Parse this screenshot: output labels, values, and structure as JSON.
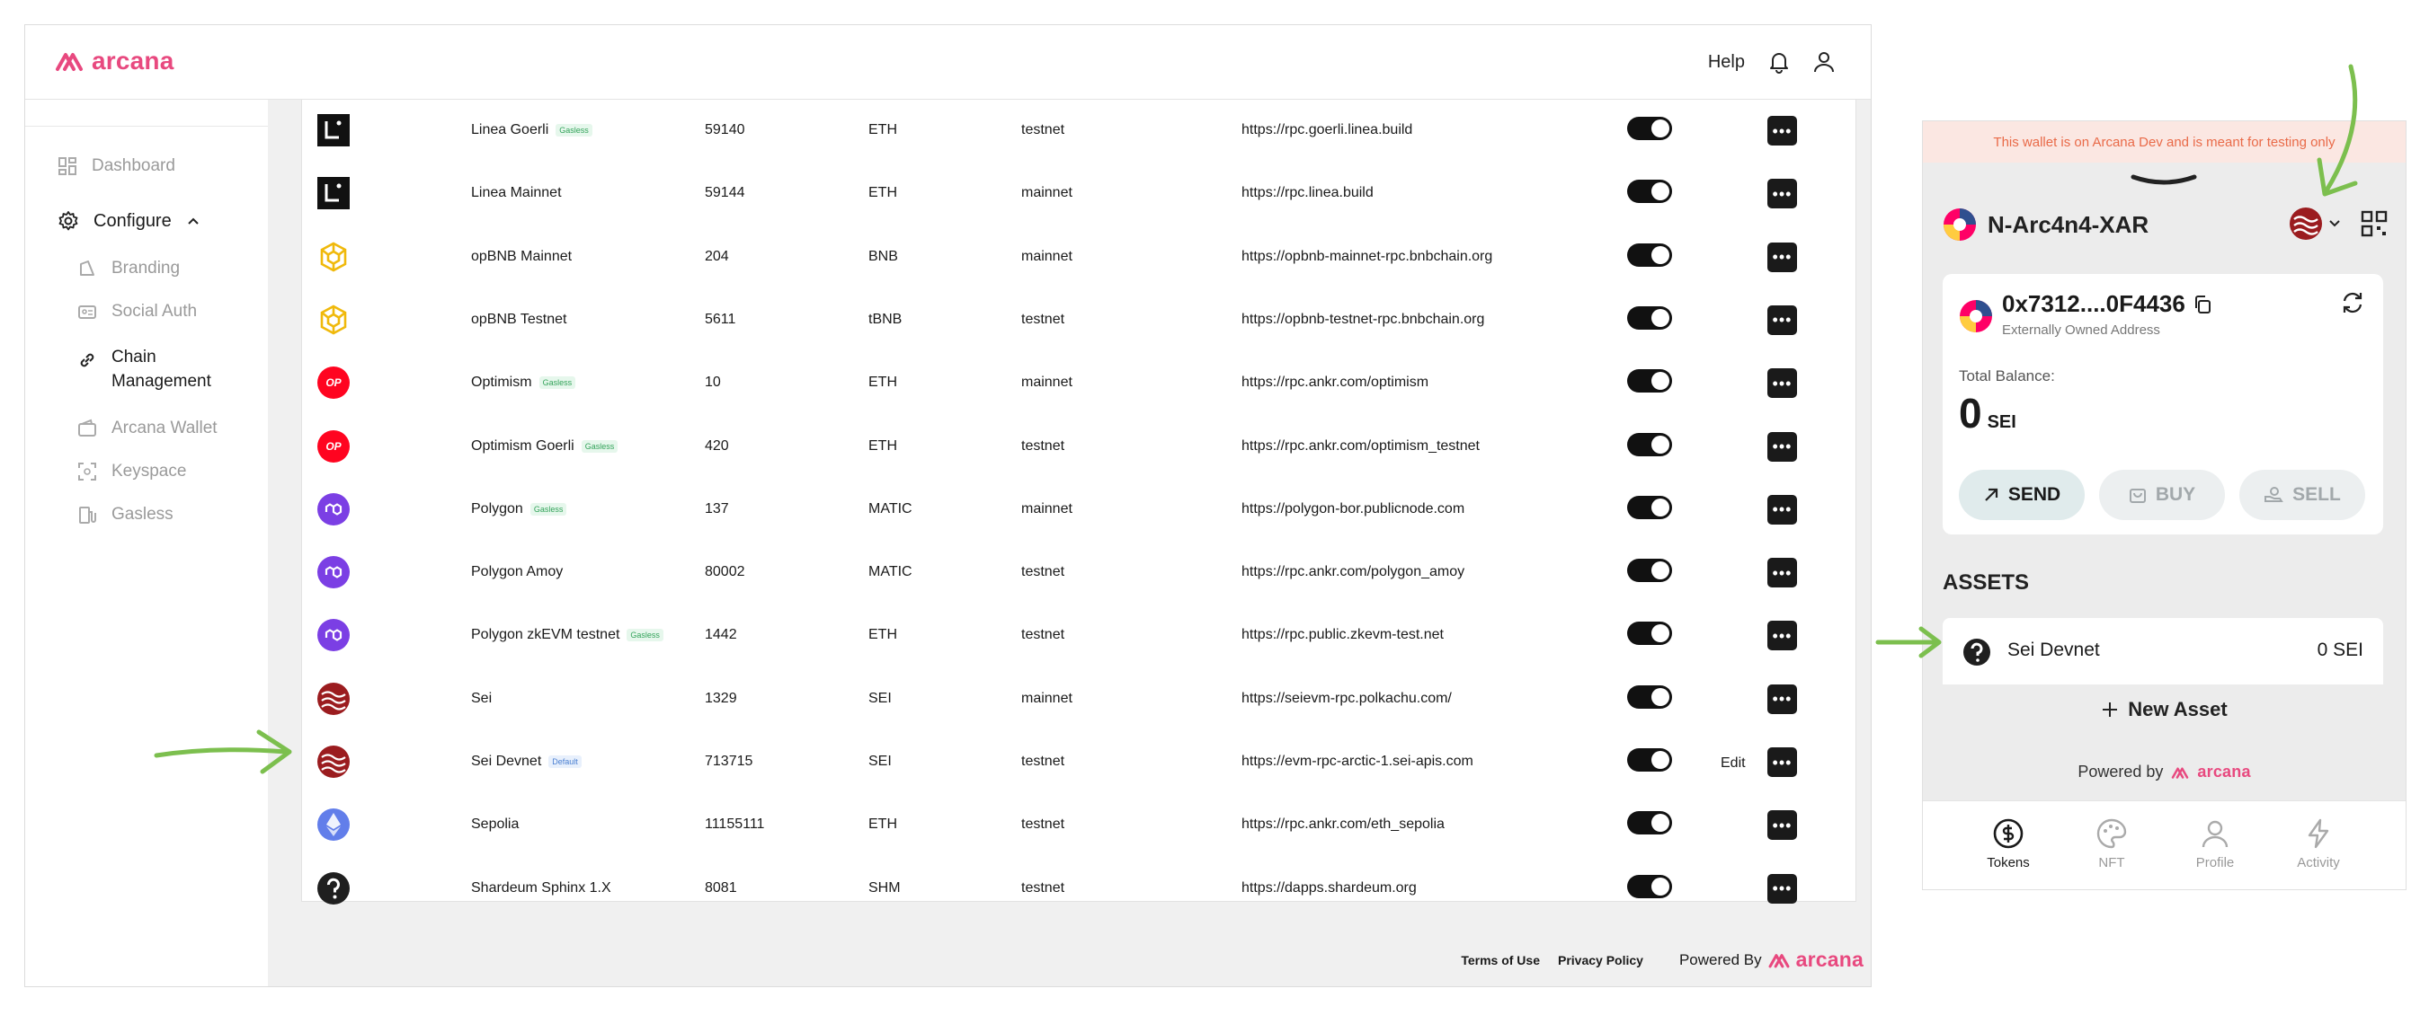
{
  "header": {
    "logo_text": "arcana",
    "help_label": "Help"
  },
  "sidebar": {
    "dashboard": "Dashboard",
    "configure": "Configure",
    "items": [
      "Branding",
      "Social Auth",
      "Chain Management",
      "Arcana Wallet",
      "Keyspace",
      "Gasless"
    ]
  },
  "table": {
    "rows": [
      {
        "name": "Linea Goerli",
        "badge": "Gasless",
        "chain_id": "59140",
        "currency": "ETH",
        "type": "testnet",
        "rpc": "https://rpc.goerli.linea.build",
        "icon": "linea-icon",
        "enabled": true
      },
      {
        "name": "Linea Mainnet",
        "badge": "",
        "chain_id": "59144",
        "currency": "ETH",
        "type": "mainnet",
        "rpc": "https://rpc.linea.build",
        "icon": "linea-icon",
        "enabled": true
      },
      {
        "name": "opBNB Mainnet",
        "badge": "",
        "chain_id": "204",
        "currency": "BNB",
        "type": "mainnet",
        "rpc": "https://opbnb-mainnet-rpc.bnbchain.org",
        "icon": "bnb-icon",
        "enabled": true
      },
      {
        "name": "opBNB Testnet",
        "badge": "",
        "chain_id": "5611",
        "currency": "tBNB",
        "type": "testnet",
        "rpc": "https://opbnb-testnet-rpc.bnbchain.org",
        "icon": "bnb-icon",
        "enabled": true
      },
      {
        "name": "Optimism",
        "badge": "Gasless",
        "chain_id": "10",
        "currency": "ETH",
        "type": "mainnet",
        "rpc": "https://rpc.ankr.com/optimism",
        "icon": "optimism-icon",
        "enabled": true
      },
      {
        "name": "Optimism Goerli",
        "badge": "Gasless",
        "chain_id": "420",
        "currency": "ETH",
        "type": "testnet",
        "rpc": "https://rpc.ankr.com/optimism_testnet",
        "icon": "optimism-icon",
        "enabled": true
      },
      {
        "name": "Polygon",
        "badge": "Gasless",
        "chain_id": "137",
        "currency": "MATIC",
        "type": "mainnet",
        "rpc": "https://polygon-bor.publicnode.com",
        "icon": "polygon-icon",
        "enabled": true
      },
      {
        "name": "Polygon Amoy",
        "badge": "",
        "chain_id": "80002",
        "currency": "MATIC",
        "type": "testnet",
        "rpc": "https://rpc.ankr.com/polygon_amoy",
        "icon": "polygon-icon",
        "enabled": true
      },
      {
        "name": "Polygon zkEVM testnet",
        "badge": "Gasless",
        "chain_id": "1442",
        "currency": "ETH",
        "type": "testnet",
        "rpc": "https://rpc.public.zkevm-test.net",
        "icon": "polygon-icon",
        "enabled": true
      },
      {
        "name": "Sei",
        "badge": "",
        "chain_id": "1329",
        "currency": "SEI",
        "type": "mainnet",
        "rpc": "https://seievm-rpc.polkachu.com/",
        "icon": "sei-icon",
        "enabled": true
      },
      {
        "name": "Sei Devnet",
        "badge": "Default",
        "chain_id": "713715",
        "currency": "SEI",
        "type": "testnet",
        "rpc": "https://evm-rpc-arctic-1.sei-apis.com",
        "icon": "sei-icon",
        "enabled": true,
        "edit": "Edit"
      },
      {
        "name": "Sepolia",
        "badge": "",
        "chain_id": "11155111",
        "currency": "ETH",
        "type": "testnet",
        "rpc": "https://rpc.ankr.com/eth_sepolia",
        "icon": "ethereum-icon",
        "enabled": true
      },
      {
        "name": "Shardeum Sphinx 1.X",
        "badge": "",
        "chain_id": "8081",
        "currency": "SHM",
        "type": "testnet",
        "rpc": "https://dapps.shardeum.org",
        "icon": "question-icon",
        "enabled": true
      }
    ],
    "more_glyph": "•••",
    "optimism_glyph": "OP"
  },
  "footer": {
    "terms": "Terms of Use",
    "privacy": "Privacy Policy",
    "powered": "Powered By",
    "logo_text": "arcana"
  },
  "wallet": {
    "warning": "This wallet is on Arcana Dev and is meant for testing only",
    "account_name": "N-Arc4n4-XAR",
    "address": "0x7312....0F4436",
    "address_type": "Externally Owned Address",
    "total_balance_label": "Total Balance:",
    "balance": "0",
    "balance_unit": "SEI",
    "buttons": {
      "send": "SEND",
      "buy": "BUY",
      "sell": "SELL"
    },
    "assets_title": "ASSETS",
    "asset": {
      "name": "Sei Devnet",
      "value": "0 SEI"
    },
    "new_asset": "New Asset",
    "powered_by": "Powered by",
    "logo_text": "arcana",
    "tabs": [
      "Tokens",
      "NFT",
      "Profile",
      "Activity"
    ]
  },
  "colors": {
    "brand": "#e8497f",
    "annotation_arrow": "#7cbf4e",
    "warning_bg": "#fbe7e2",
    "warning_text": "#e96a48",
    "badge_gasless": "#33a35a",
    "badge_default": "#4a7fd1"
  }
}
